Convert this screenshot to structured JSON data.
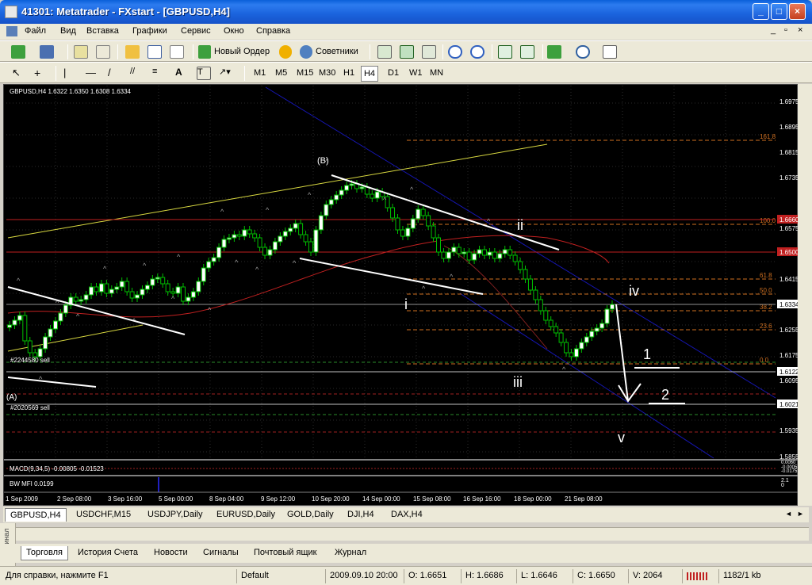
{
  "window": {
    "title": "41301: Metatrader - FXstart - [GBPUSD,H4]"
  },
  "menu": [
    "Файл",
    "Вид",
    "Вставка",
    "Графики",
    "Сервис",
    "Окно",
    "Справка"
  ],
  "toolbar": {
    "new_order": "Новый Ордер",
    "experts": "Советники"
  },
  "timeframes": [
    "M1",
    "M5",
    "M15",
    "M30",
    "H1",
    "H4",
    "D1",
    "W1",
    "MN"
  ],
  "active_timeframe": "H4",
  "chart": {
    "info": "GBPUSD,H4  1.6322  1.6350  1.6308  1.6334",
    "order1_label": "#2244580 sell",
    "order2_label": "#2020569 sell",
    "macd_label": "MACD(9,34,5) -0.00805 -0.01523",
    "mfi_label": "BW MFI 0.0199",
    "wave_labels": {
      "B": "(B)",
      "A": "(A)",
      "i": "i",
      "ii": "ii",
      "iii": "iii",
      "iv": "iv",
      "v": "v",
      "one": "1",
      "two": "2"
    },
    "fib_levels": [
      "161.8",
      "100.0",
      "61.8",
      "50.0",
      "38.2",
      "23.6",
      "0.0"
    ],
    "price_axis": [
      "1.6975",
      "1.6895",
      "1.6815",
      "1.6735",
      "1.6575",
      "1.6415",
      "1.6255",
      "1.6175",
      "1.6095",
      "1.5935",
      "1.5855"
    ],
    "price_tags": {
      "current": "1.6334",
      "red1": "1.6660",
      "red2": "1.6500",
      "line1": "1.6122",
      "line2": "1.6021"
    },
    "macd_axis": [
      "0.0060",
      "-0.0005",
      "-0.0175"
    ],
    "mfi_axis": [
      "2.1",
      "0"
    ],
    "time_axis": [
      "1 Sep 2009",
      "2 Sep 08:00",
      "3 Sep 16:00",
      "5 Sep 00:00",
      "8 Sep 04:00",
      "9 Sep 12:00",
      "10 Sep 20:00",
      "14 Sep 00:00",
      "15 Sep 08:00",
      "16 Sep 16:00",
      "18 Sep 00:00",
      "21 Sep 08:00"
    ]
  },
  "chart_tabs": [
    "GBPUSD,H4",
    "USDCHF,M15",
    "USDJPY,Daily",
    "EURUSD,Daily",
    "GOLD,Daily",
    "DJI,H4",
    "DAX,H4"
  ],
  "terminal": {
    "side_label": "Терминал",
    "tabs": [
      "Торговля",
      "История Счета",
      "Новости",
      "Сигналы",
      "Почтовый ящик",
      "Журнал"
    ]
  },
  "status": {
    "help": "Для справки, нажмите F1",
    "profile": "Default",
    "datetime": "2009.09.10 20:00",
    "open": "O: 1.6651",
    "high": "H: 1.6686",
    "low": "L: 1.6646",
    "close": "C: 1.6650",
    "volume": "V: 2064",
    "traffic": "1182/1 kb"
  }
}
